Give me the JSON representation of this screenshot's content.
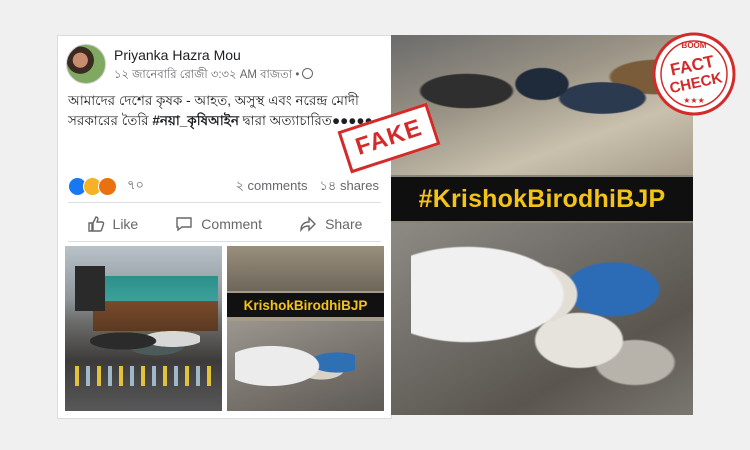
{
  "post": {
    "author_name": "Priyanka Hazra Mou",
    "meta": "১২ জানেবারি রোজী ৩:৩২ AM বাজতা •",
    "text_main": "আমাদের দেশের কৃষক - আহত, অসুস্থ এবং নরেন্দ্র মোদী সরকারের তৈরি ",
    "hashtag": "#নয়া_কৃষিআইন",
    "text_tail": " দ্বারা অত্যাচারিত●●●●●",
    "reaction_count": "৭০",
    "comments": "২ comments",
    "shares": "১৪ shares",
    "actions": {
      "like": "Like",
      "comment": "Comment",
      "share": "Share"
    },
    "small_banner": "KrishokBirodhiBJP"
  },
  "right_banner": "#KrishokBirodhiBJP",
  "fake_stamp": "FAKE",
  "seal": {
    "top": "BOOM",
    "line1": "FACT",
    "line2": "CHECK",
    "stars": "★★★"
  },
  "colors": {
    "stamp_red": "#d32a2a",
    "banner_yellow": "#f3c318",
    "fb_blue": "#1877f2"
  }
}
